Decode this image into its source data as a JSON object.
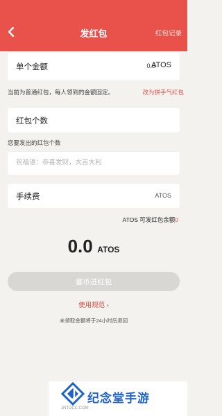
{
  "header": {
    "title": "发红包",
    "record_link": "红包记录",
    "back_icon": "chevron-left-icon"
  },
  "amount": {
    "label": "单个金额",
    "value": "0.0",
    "unit": "ATOS"
  },
  "hint": {
    "text": "当前为普通红包，每人领到的金额固定。",
    "switch_link": "改为拼手气红包"
  },
  "count": {
    "label": "红包个数",
    "hint": "您要发出的红包个数"
  },
  "blessing": {
    "placeholder": "祝福语：恭喜发财，大吉大利",
    "value": ""
  },
  "fee": {
    "label": "手续费",
    "unit": "ATOS"
  },
  "balance": {
    "label": "ATOS 可发红包余额",
    "value": "0"
  },
  "total": {
    "amount": "0.0",
    "unit": "ATOS"
  },
  "submit": {
    "label": "塞币进红包"
  },
  "rules": {
    "label": "使用规范",
    "chevron": "›"
  },
  "refund_note": "未领取金额将于24小时后退回",
  "watermark": {
    "text": "纪念堂手游",
    "url": "JNTDCC.COM",
    "logo_icon": "jntdcc-logo"
  },
  "colors": {
    "brand_red": "#e8524a",
    "disabled_button": "#d8d7d4",
    "background": "#f3f2ef",
    "watermark_blue": "#1f63c9"
  }
}
